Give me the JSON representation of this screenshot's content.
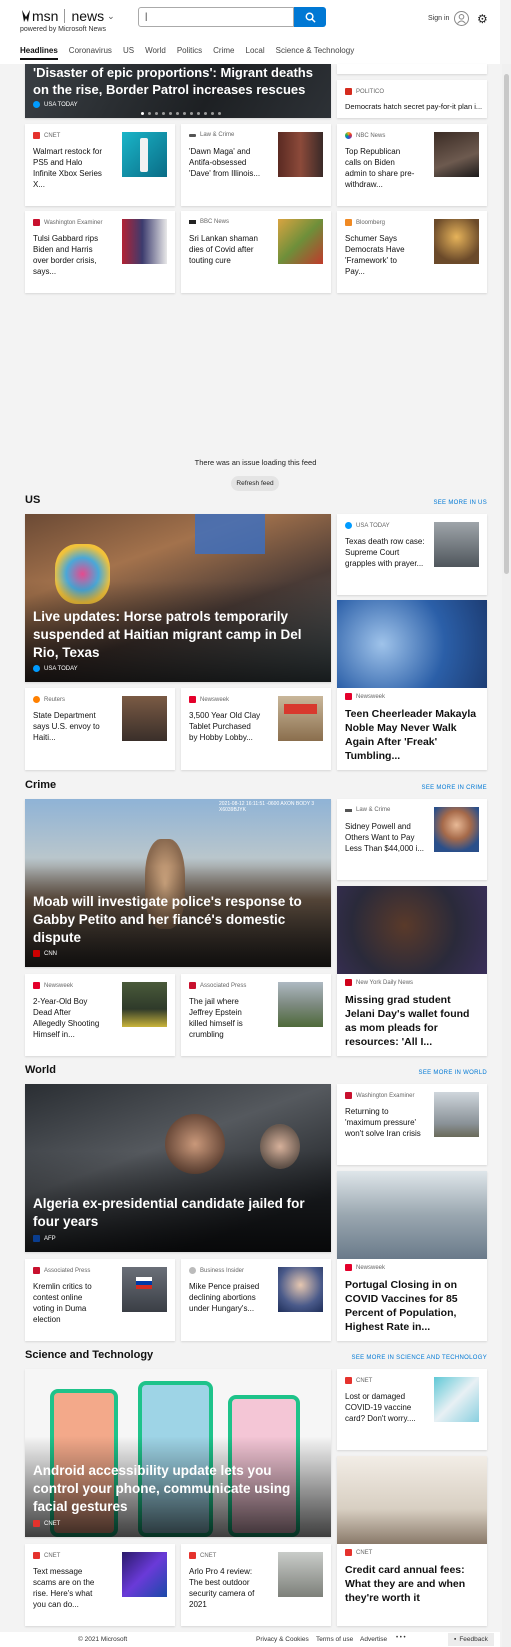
{
  "header": {
    "logo_msn": "msn",
    "logo_news": "news",
    "powered_by": "powered by Microsoft News",
    "search_value": "|",
    "signin": "Sign in"
  },
  "nav": [
    "Headlines",
    "Coronavirus",
    "US",
    "World",
    "Politics",
    "Crime",
    "Local",
    "Science & Technology"
  ],
  "top": {
    "hero": {
      "title": "'Disaster of epic proportions': Migrant deaths on the rise, Border Patrol increases rescues",
      "source": "USA TODAY",
      "slides": 12
    },
    "side_top": {
      "source": "POLITICO",
      "title": "Democrats hatch secret pay-for-it plan i..."
    },
    "cards": [
      {
        "source": "CNET",
        "title": "Walmart restock for PS5 and Halo Infinite Xbox Series X...",
        "src_color": "#e5322d"
      },
      {
        "source": "Law & Crime",
        "title": "'Dawn Maga' and Antifa-obsessed 'Dave' from Illinois...",
        "src_color": "#555"
      },
      {
        "source": "NBC News",
        "title": "Top Republican calls on Biden admin to share pre-withdraw...",
        "src_color": "#6a3fb5"
      },
      {
        "source": "Washington Examiner",
        "title": "Tulsi Gabbard rips Biden and Harris over border crisis, says...",
        "src_color": "#c8102e"
      },
      {
        "source": "BBC News",
        "title": "Sri Lankan shaman dies of Covid after touting cure",
        "src_color": "#222"
      },
      {
        "source": "Bloomberg",
        "title": "Schumer Says Democrats Have 'Framework' to Pay...",
        "src_color": "#f08a24"
      }
    ]
  },
  "feed_error": {
    "message": "There was an issue loading this feed",
    "button": "Refresh feed"
  },
  "sections": {
    "us": {
      "heading": "US",
      "see_more": "SEE MORE IN US",
      "hero": {
        "title": "Live updates: Horse patrols temporarily suspended at Haitian migrant camp in Del Rio, Texas",
        "source": "USA TODAY"
      },
      "side_small": {
        "source": "USA TODAY",
        "title": "Texas death row case: Supreme Court grapples with prayer..."
      },
      "side_big": {
        "source": "Newsweek",
        "title": "Teen Cheerleader Makayla Noble May Never Walk Again After 'Freak' Tumbling..."
      },
      "cards": [
        {
          "source": "Reuters",
          "title": "State Department says U.S. envoy to Haiti..."
        },
        {
          "source": "Newsweek",
          "title": "3,500 Year Old Clay Tablet Purchased by Hobby Lobby..."
        }
      ]
    },
    "crime": {
      "heading": "Crime",
      "see_more": "SEE MORE IN CRIME",
      "hero": {
        "title": "Moab will investigate police's response to Gabby Petito and her fiancé's domestic dispute",
        "source": "CNN",
        "cam_text": "2021-08-12 16:11:51 -0600 AXON BODY 3 X6039BJYK"
      },
      "side_small": {
        "source": "Law & Crime",
        "title": "Sidney Powell and Others Want to Pay Less Than $44,000 i..."
      },
      "side_big": {
        "source": "New York Daily News",
        "title": "Missing grad student Jelani Day's wallet found as mom pleads for resources: 'All I..."
      },
      "cards": [
        {
          "source": "Newsweek",
          "title": "2-Year-Old Boy Dead After Allegedly Shooting Himself in..."
        },
        {
          "source": "Associated Press",
          "title": "The jail where Jeffrey Epstein killed himself is crumbling"
        }
      ]
    },
    "world": {
      "heading": "World",
      "see_more": "SEE MORE IN WORLD",
      "hero": {
        "title": "Algeria ex-presidential candidate jailed for four years",
        "source": "AFP"
      },
      "side_small": {
        "source": "Washington Examiner",
        "title": "Returning to 'maximum pressure' won't solve Iran crisis"
      },
      "side_big": {
        "source": "Newsweek",
        "title": "Portugal Closing in on COVID Vaccines for 85 Percent of Population, Highest Rate in..."
      },
      "cards": [
        {
          "source": "Associated Press",
          "title": "Kremlin critics to contest online voting in Duma election"
        },
        {
          "source": "Business Insider",
          "title": "Mike Pence praised declining abortions under Hungary's..."
        }
      ]
    },
    "scitech": {
      "heading": "Science and Technology",
      "see_more": "SEE MORE IN SCIENCE AND TECHNOLOGY",
      "hero": {
        "title": "Android accessibility update lets you control your phone, communicate using facial gestures",
        "source": "CNET"
      },
      "side_small": {
        "source": "CNET",
        "title": "Lost or damaged COVID-19 vaccine card? Don't worry...."
      },
      "side_big": {
        "source": "CNET",
        "title": "Credit card annual fees: What they are and when they're worth it"
      },
      "cards": [
        {
          "source": "CNET",
          "title": "Text message scams are on the rise. Here's what you can do..."
        },
        {
          "source": "CNET",
          "title": "Arlo Pro 4 review: The best outdoor security camera of 2021"
        }
      ]
    }
  },
  "footer": {
    "copyright": "© 2021 Microsoft",
    "privacy": "Privacy & Cookies",
    "terms": "Terms of use",
    "advertise": "Advertise",
    "more": "• • •",
    "feedback": "Feedback"
  },
  "colors": {
    "accent": "#0078d4",
    "cnet": "#e5322d",
    "newsweek": "#e4002b",
    "usatoday": "#009bff"
  }
}
